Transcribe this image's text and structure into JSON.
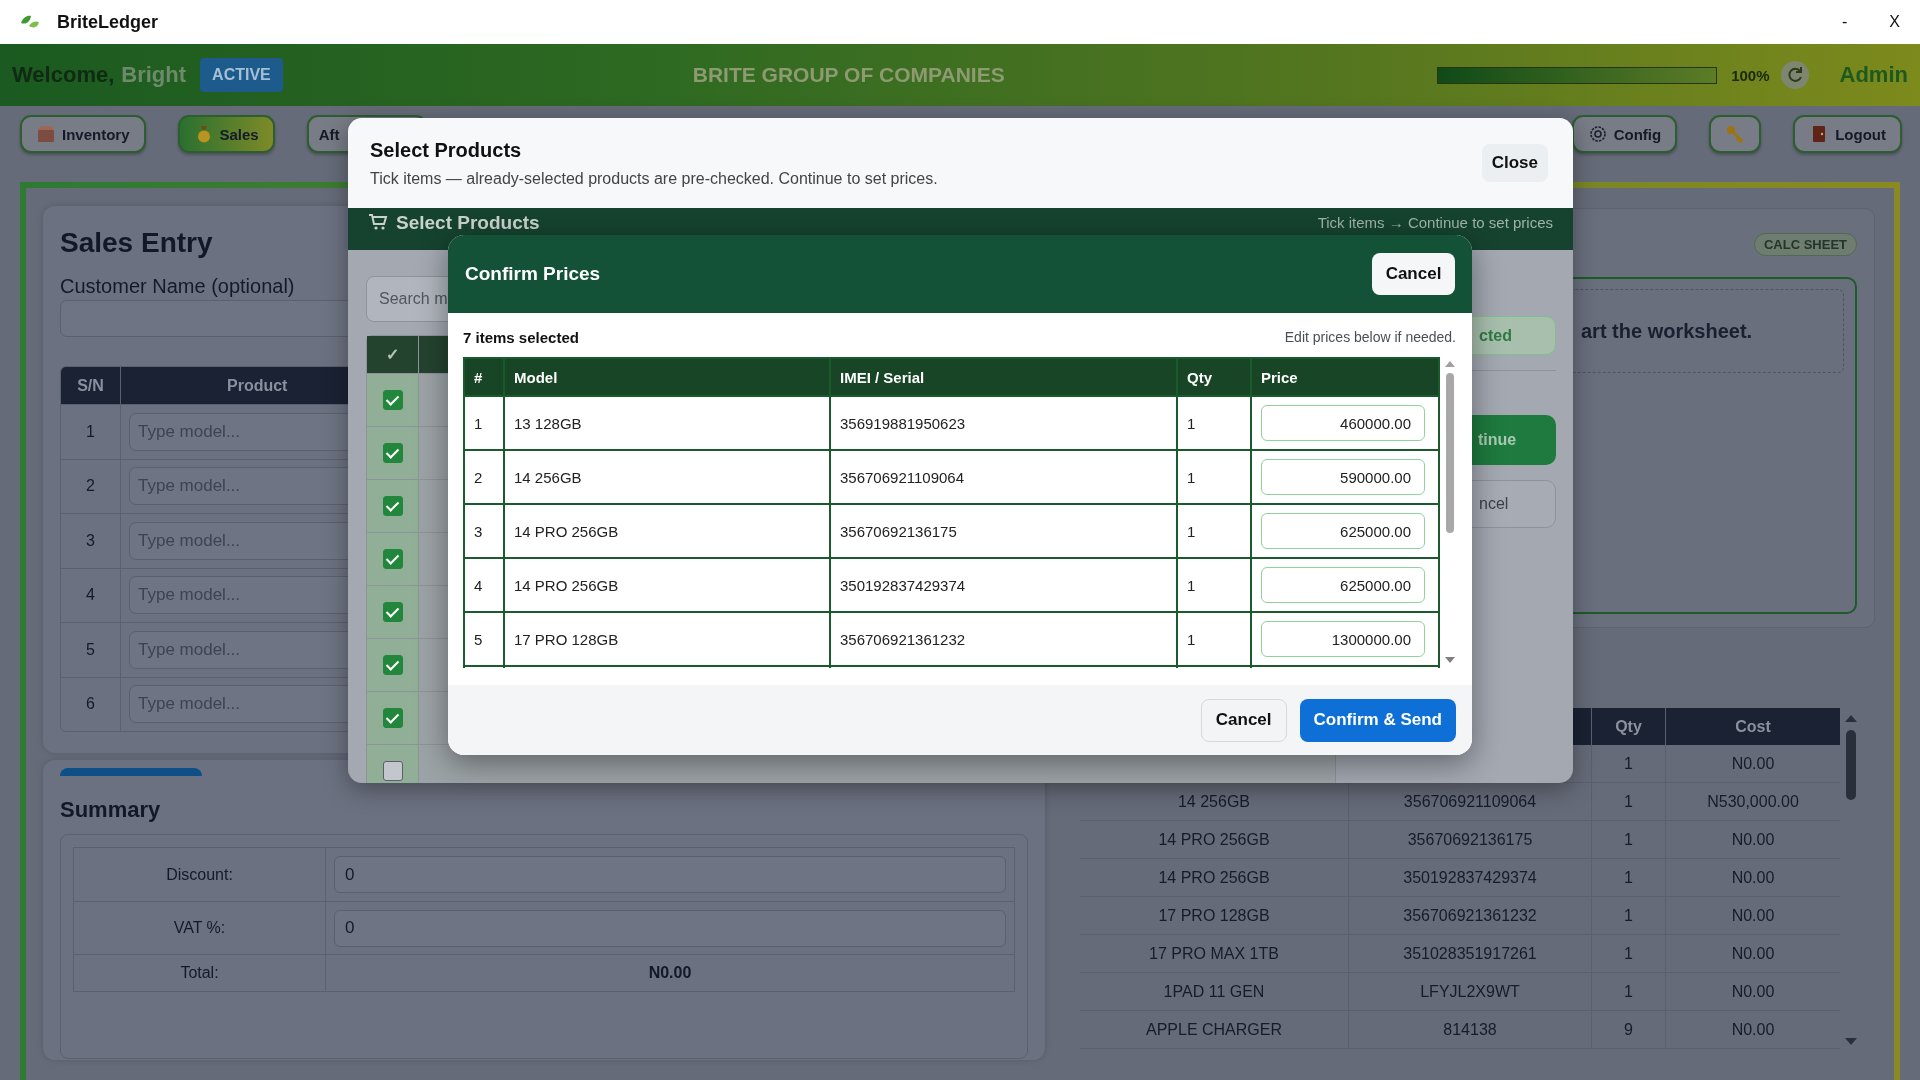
{
  "app": {
    "title": "BriteLedger",
    "controls": [
      "-",
      "X"
    ]
  },
  "header": {
    "greeting": "Welcome,",
    "user": "Bright",
    "status": "ACTIVE",
    "company": "BRITE GROUP OF COMPANIES",
    "progress": {
      "level": 1,
      "reading": "100%"
    },
    "role": "Admin"
  },
  "nav": {
    "left": [
      {
        "label": "Inventory",
        "selected": false
      },
      {
        "label": "Sales",
        "selected": true
      },
      {
        "label": "Aft",
        "selected": false
      }
    ],
    "right": [
      {
        "label": "Config",
        "selected": false
      },
      {
        "selected": false
      },
      {
        "label": "Logout",
        "selected": false
      }
    ]
  },
  "sales_entry": {
    "title": "Sales Entry",
    "customer_label": "Customer Name (optional)",
    "columns": [
      "S/N",
      "Product"
    ],
    "rows": [
      {
        "sn": "1",
        "placeholder": "Type model..."
      },
      {
        "sn": "2",
        "placeholder": "Type model..."
      },
      {
        "sn": "3",
        "placeholder": "Type model..."
      },
      {
        "sn": "4",
        "placeholder": "Type model..."
      },
      {
        "sn": "5",
        "placeholder": "Type model..."
      },
      {
        "sn": "6",
        "placeholder": "Type model..."
      }
    ]
  },
  "summary": {
    "title": "Summary",
    "rows": [
      {
        "label": "Discount:",
        "kind": "input",
        "value": "0"
      },
      {
        "label": "VAT %:",
        "kind": "input",
        "value": "0"
      },
      {
        "label": "Total:",
        "kind": "text",
        "value": "N0.00"
      }
    ]
  },
  "calc_sheet": {
    "badge": "CALC SHEET",
    "hint": "art the worksheet."
  },
  "cart_table": {
    "columns": [
      "Qty",
      "Cost"
    ],
    "rows": [
      {
        "qty": "1",
        "cost": "N0.00"
      },
      {
        "model": "14 256GB",
        "imei": "356706921109064",
        "qty": "1",
        "cost": "N530,000.00"
      },
      {
        "model": "14 PRO 256GB",
        "imei": "35670692136175",
        "qty": "1",
        "cost": "N0.00"
      },
      {
        "model": "14 PRO 256GB",
        "imei": "350192837429374",
        "qty": "1",
        "cost": "N0.00"
      },
      {
        "model": "17 PRO 128GB",
        "imei": "356706921361232",
        "qty": "1",
        "cost": "N0.00"
      },
      {
        "model": "17 PRO MAX 1TB",
        "imei": "351028351917261",
        "qty": "1",
        "cost": "N0.00"
      },
      {
        "model": "1PAD 11 GEN",
        "imei": "LFYJL2X9WT",
        "qty": "1",
        "cost": "N0.00"
      },
      {
        "model": "APPLE CHARGER",
        "imei": "814138",
        "qty": "9",
        "cost": "N0.00"
      }
    ]
  },
  "select_modal": {
    "title": "Select Products",
    "subtitle": "Tick items — already-selected products are pre-checked. Continue to set prices.",
    "close": "Close",
    "bar_title": "Select Products",
    "bar_hint": "Tick items → Continue to set prices",
    "search_placeholder": "Search m",
    "check_header": "✓",
    "rows": [
      {
        "checked": true
      },
      {
        "checked": true
      },
      {
        "checked": true
      },
      {
        "checked": true
      },
      {
        "checked": true
      },
      {
        "checked": true
      },
      {
        "checked": true
      },
      {
        "checked": false
      }
    ],
    "side_buttons": [
      {
        "label": "cted",
        "kind": "outline-green"
      },
      {
        "label": "tinue",
        "kind": "primary"
      },
      {
        "label": "ncel",
        "kind": "outline"
      }
    ]
  },
  "confirm_modal": {
    "title": "Confirm Prices",
    "cancel": "Cancel",
    "count": "7 items selected",
    "hint": "Edit prices below if needed.",
    "columns": [
      "#",
      "Model",
      "IMEI / Serial",
      "Qty",
      "Price"
    ],
    "rows": [
      {
        "n": "1",
        "model": "13 128GB",
        "imei": "356919881950623",
        "qty": "1",
        "price": "460000.00"
      },
      {
        "n": "2",
        "model": "14 256GB",
        "imei": "356706921109064",
        "qty": "1",
        "price": "590000.00"
      },
      {
        "n": "3",
        "model": "14 PRO 256GB",
        "imei": "35670692136175",
        "qty": "1",
        "price": "625000.00"
      },
      {
        "n": "4",
        "model": "14 PRO 256GB",
        "imei": "350192837429374",
        "qty": "1",
        "price": "625000.00"
      },
      {
        "n": "5",
        "model": "17 PRO 128GB",
        "imei": "356706921361232",
        "qty": "1",
        "price": "1300000.00"
      }
    ],
    "buttons": [
      {
        "label": "Cancel",
        "kind": "secondary"
      },
      {
        "label": "Confirm & Send",
        "kind": "primary"
      }
    ]
  }
}
